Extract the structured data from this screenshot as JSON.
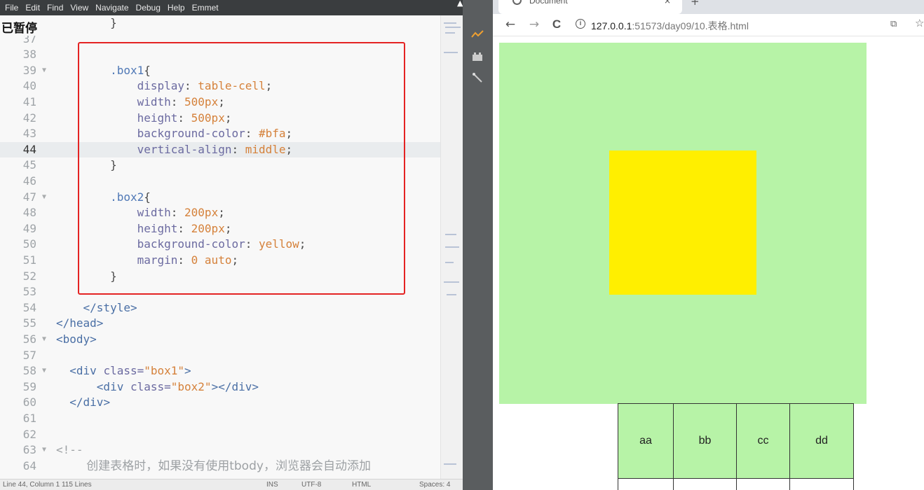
{
  "menubar": {
    "items": [
      "File",
      "Edit",
      "Find",
      "View",
      "Navigate",
      "Debug",
      "Help",
      "Emmet"
    ]
  },
  "editor": {
    "overlay_label": "已暂停",
    "lines": [
      {
        "n": "",
        "code": "        }"
      },
      {
        "n": "37",
        "code": ""
      },
      {
        "n": "38",
        "code": ""
      },
      {
        "n": "39",
        "code": "        .box1{",
        "fold": true
      },
      {
        "n": "40",
        "code": "            display: table-cell;"
      },
      {
        "n": "41",
        "code": "            width: 500px;"
      },
      {
        "n": "42",
        "code": "            height: 500px;"
      },
      {
        "n": "43",
        "code": "            background-color: #bfa;"
      },
      {
        "n": "44",
        "code": "            vertical-align: middle;",
        "active": true
      },
      {
        "n": "45",
        "code": "        }"
      },
      {
        "n": "46",
        "code": ""
      },
      {
        "n": "47",
        "code": "        .box2{",
        "fold": true
      },
      {
        "n": "48",
        "code": "            width: 200px;"
      },
      {
        "n": "49",
        "code": "            height: 200px;"
      },
      {
        "n": "50",
        "code": "            background-color: yellow;"
      },
      {
        "n": "51",
        "code": "            margin: 0 auto;"
      },
      {
        "n": "52",
        "code": "        }"
      },
      {
        "n": "53",
        "code": ""
      },
      {
        "n": "54",
        "code": "    </style>"
      },
      {
        "n": "55",
        "code": "</head>"
      },
      {
        "n": "56",
        "code": "<body>",
        "fold": true
      },
      {
        "n": "57",
        "code": ""
      },
      {
        "n": "58",
        "code": "  <div class=\"box1\">",
        "fold": true
      },
      {
        "n": "59",
        "code": "      <div class=\"box2\"></div>"
      },
      {
        "n": "60",
        "code": "  </div>"
      },
      {
        "n": "61",
        "code": ""
      },
      {
        "n": "62",
        "code": ""
      },
      {
        "n": "63",
        "code": "<!--",
        "fold": true
      },
      {
        "n": "64",
        "code": "        创建表格时，如果没有使用tbody，浏览器会自动添加"
      }
    ]
  },
  "statusbar": {
    "position": "Line 44, Column 1",
    "line_count": "115 Lines",
    "mode": "INS",
    "encoding": "UTF-8",
    "language": "HTML",
    "spaces": "Spaces: 4"
  },
  "browser": {
    "tab_title": "Document",
    "tab_close": "×",
    "new_tab": "+",
    "back": "←",
    "forward": "→",
    "reload": "C",
    "url_host": "127.0.0.1",
    "url_path": ":51573/day09/10.表格.html",
    "table_cells": [
      "aa",
      "bb",
      "cc",
      "dd"
    ]
  },
  "colors": {
    "box1": "#bfa",
    "box2": "yellow",
    "highlight": "#e42323"
  }
}
